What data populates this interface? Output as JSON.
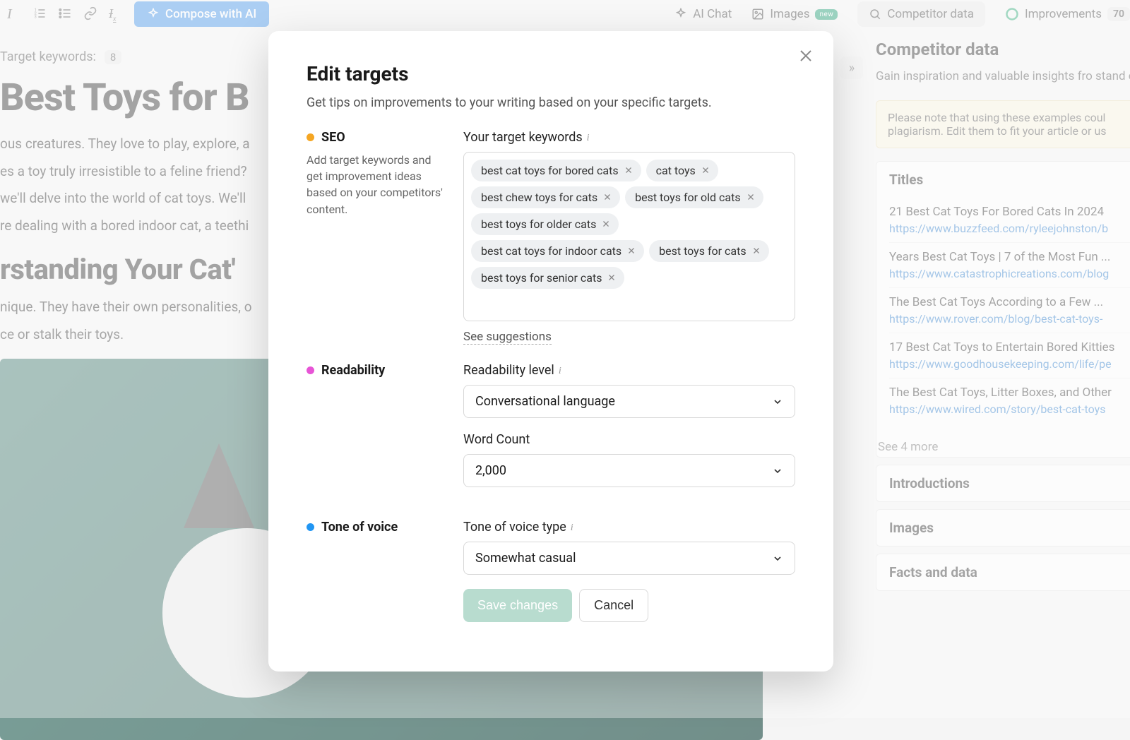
{
  "toolbar": {
    "compose_label": "Compose with AI",
    "ai_chat": "AI Chat",
    "images": "Images",
    "images_badge": "new",
    "competitor_data": "Competitor data",
    "improvements": "Improvements",
    "improvements_count": "70"
  },
  "editor": {
    "keywords_label": "Target keywords:",
    "keywords_count": "8",
    "h1": "Best Toys for B",
    "p1": "ous creatures. They love to play, explore, a",
    "p2": "es a toy truly irresistible to a feline friend?",
    "p3": "we'll delve into the world of cat toys. We'll",
    "p4": "re dealing with a bored indoor cat, a teethi",
    "h2": "rstanding Your Cat'",
    "p5": "nique. They have their own personalities, o",
    "p6": "ce or stalk their toys."
  },
  "right": {
    "title": "Competitor data",
    "subtitle": "Gain inspiration and valuable insights fro stand out.",
    "warn": "Please note that using these examples coul plagiarism. Edit them to fit your article or us",
    "acc_titles": "Titles",
    "acc_intros": "Introductions",
    "acc_images": "Images",
    "acc_facts": "Facts and data",
    "results": [
      {
        "t": "21 Best Cat Toys For Bored Cats In 2024",
        "u": "https://www.buzzfeed.com/ryleejohnston/b"
      },
      {
        "t": "Years Best Cat Toys | 7 of the Most Fun ...",
        "u": "https://www.catastrophicreations.com/blog"
      },
      {
        "t": "The Best Cat Toys According to a Few ...",
        "u": "https://www.rover.com/blog/best-cat-toys-"
      },
      {
        "t": "17 Best Cat Toys to Entertain Bored Kitties",
        "u": "https://www.goodhousekeeping.com/life/pe"
      },
      {
        "t": "The Best Cat Toys, Litter Boxes, and Other",
        "u": "https://www.wired.com/story/best-cat-toys"
      }
    ],
    "see_more": "See 4 more"
  },
  "modal": {
    "title": "Edit targets",
    "sub": "Get tips on improvements to your writing based on your specific targets.",
    "seo_head": "SEO",
    "seo_desc": "Add target keywords and get improvement ideas based on your competitors' content.",
    "keywords_label": "Your target keywords",
    "keywords": [
      "best cat toys for bored cats",
      "cat toys",
      "best chew toys for cats",
      "best toys for old cats",
      "best toys for older cats",
      "best cat toys for indoor cats",
      "best toys for cats",
      "best toys for senior cats"
    ],
    "see_suggestions": "See suggestions",
    "readability_head": "Readability",
    "readability_label": "Readability level",
    "readability_value": "Conversational language",
    "wordcount_label": "Word Count",
    "wordcount_value": "2,000",
    "tone_head": "Tone of voice",
    "tone_label": "Tone of voice type",
    "tone_value": "Somewhat casual",
    "save": "Save changes",
    "cancel": "Cancel"
  }
}
